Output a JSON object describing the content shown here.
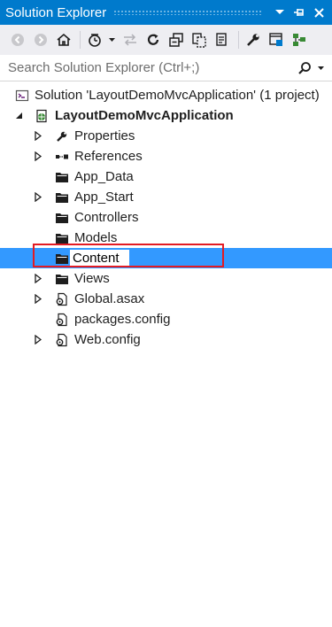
{
  "panel": {
    "title": "Solution Explorer"
  },
  "title_buttons": [
    "dropdown",
    "pin",
    "close"
  ],
  "search": {
    "placeholder": "Search Solution Explorer (Ctrl+;)"
  },
  "tree": {
    "solution": "Solution 'LayoutDemoMvcApplication' (1 project)",
    "project": "LayoutDemoMvcApplication",
    "items": [
      {
        "label": "Properties"
      },
      {
        "label": "References"
      },
      {
        "label": "App_Data"
      },
      {
        "label": "App_Start"
      },
      {
        "label": "Controllers"
      },
      {
        "label": "Models"
      },
      {
        "label": "Content"
      },
      {
        "label": "Views"
      },
      {
        "label": "Global.asax"
      },
      {
        "label": "packages.config"
      },
      {
        "label": "Web.config"
      }
    ]
  },
  "colors": {
    "accent": "#007acc",
    "selection": "#3399ff",
    "highlight": "#e31b23",
    "toolbar": "#eeeef2"
  }
}
